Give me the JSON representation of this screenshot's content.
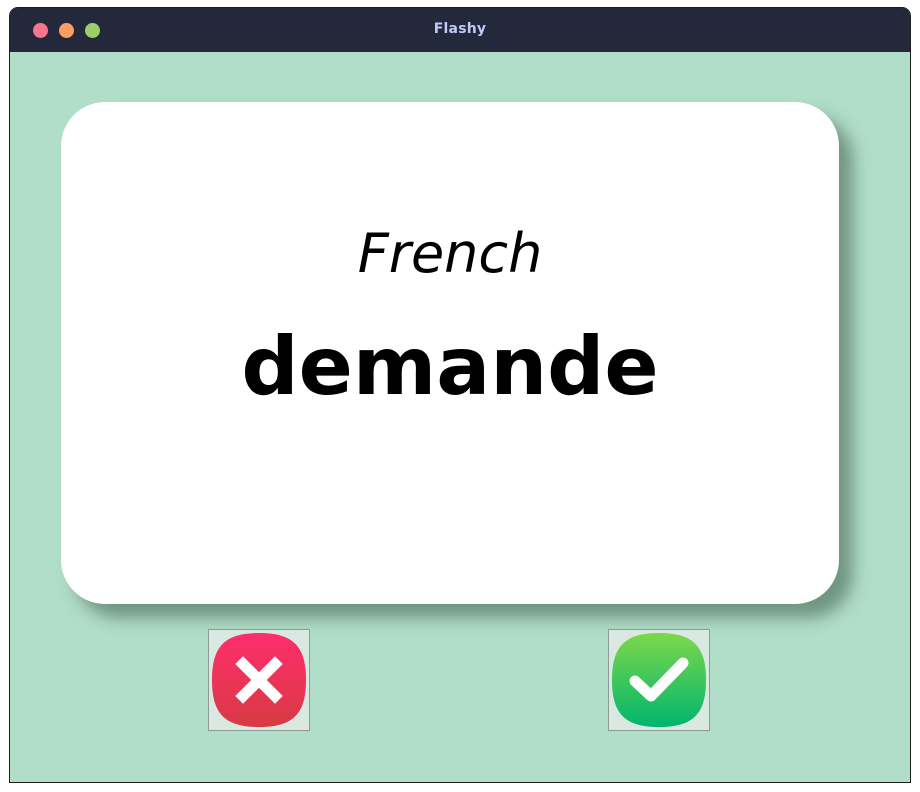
{
  "window": {
    "title": "Flashy"
  },
  "card": {
    "language": "French",
    "word": "demande"
  },
  "buttons": {
    "wrong": {
      "icon": "x-icon"
    },
    "right": {
      "icon": "check-icon"
    }
  },
  "colors": {
    "background": "#b1dec8",
    "titlebar": "#24283b",
    "card": "#ffffff",
    "wrong_button": "#e63950",
    "right_button": "#1fbf6a"
  }
}
